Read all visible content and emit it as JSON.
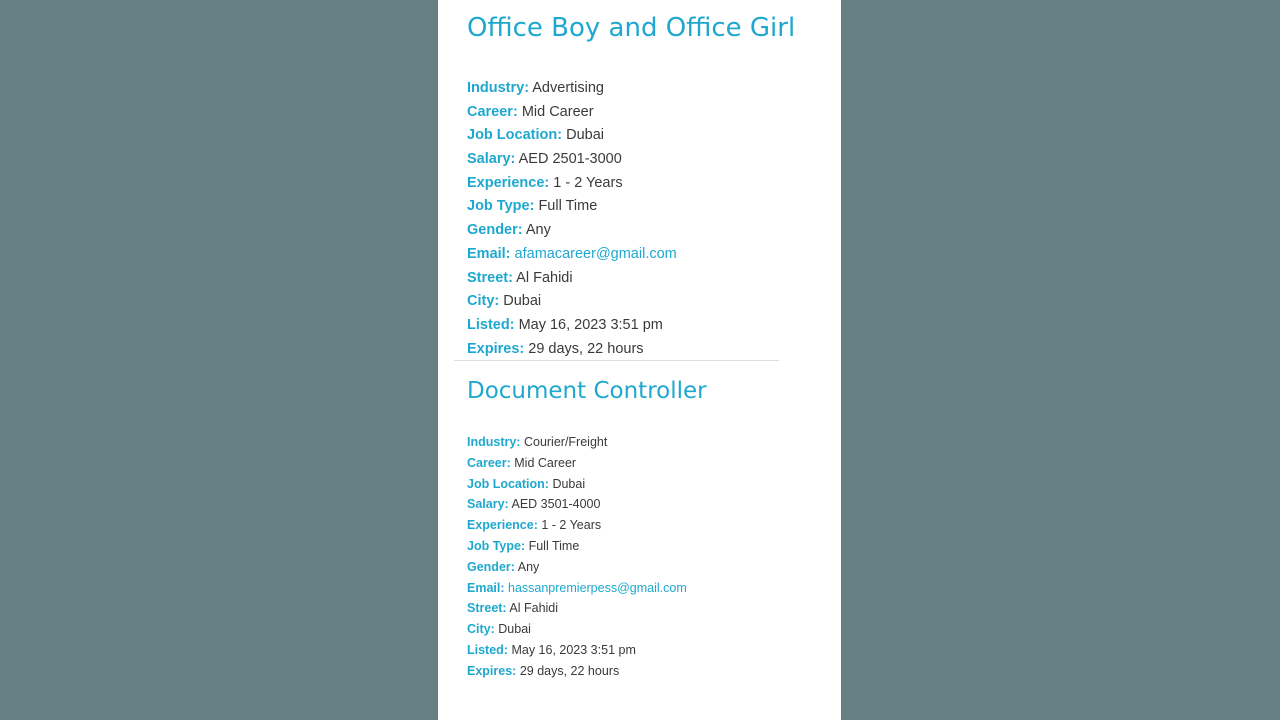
{
  "listings": [
    {
      "title": "Office Boy and Office Girl",
      "fields": {
        "industry": {
          "label": "Industry:",
          "value": "Advertising"
        },
        "career": {
          "label": "Career:",
          "value": "Mid Career"
        },
        "job_location": {
          "label": "Job Location:",
          "value": "Dubai"
        },
        "salary": {
          "label": "Salary:",
          "value": "AED 2501-3000"
        },
        "experience": {
          "label": "Experience:",
          "value": "1 - 2 Years"
        },
        "job_type": {
          "label": "Job Type:",
          "value": "Full Time"
        },
        "gender": {
          "label": "Gender:",
          "value": "Any"
        },
        "email": {
          "label": "Email:",
          "value": "afamacareer@gmail.com"
        },
        "street": {
          "label": "Street:",
          "value": "Al Fahidi"
        },
        "city": {
          "label": "City:",
          "value": "Dubai"
        },
        "listed": {
          "label": "Listed:",
          "value": "May 16, 2023 3:51 pm"
        },
        "expires": {
          "label": "Expires:",
          "value": "29 days, 22 hours"
        }
      }
    },
    {
      "title": "Document Controller",
      "fields": {
        "industry": {
          "label": "Industry:",
          "value": "Courier/Freight"
        },
        "career": {
          "label": "Career:",
          "value": "Mid Career"
        },
        "job_location": {
          "label": "Job Location:",
          "value": "Dubai"
        },
        "salary": {
          "label": "Salary:",
          "value": "AED 3501-4000"
        },
        "experience": {
          "label": "Experience:",
          "value": "1 - 2 Years"
        },
        "job_type": {
          "label": "Job Type:",
          "value": "Full Time"
        },
        "gender": {
          "label": "Gender:",
          "value": "Any"
        },
        "email": {
          "label": "Email:",
          "value": "hassanpremierpess@gmail.com"
        },
        "street": {
          "label": "Street:",
          "value": "Al Fahidi"
        },
        "city": {
          "label": "City:",
          "value": "Dubai"
        },
        "listed": {
          "label": "Listed:",
          "value": "May 16, 2023 3:51 pm"
        },
        "expires": {
          "label": "Expires:",
          "value": "29 days, 22 hours"
        }
      }
    }
  ],
  "colors": {
    "accent": "#1fa8cf",
    "text": "#3a3a3a",
    "backdrop": "#657f83",
    "page": "#ffffff"
  }
}
